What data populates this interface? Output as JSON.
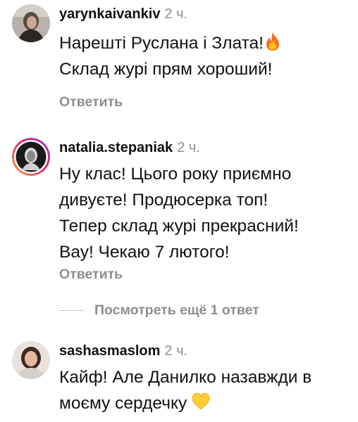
{
  "comments": [
    {
      "username": "yarynkaivankiv",
      "time": "2 ч.",
      "lines": [
        "Нарешті Руслана і Злата!",
        "Склад журі прям хороший!"
      ],
      "emoji": "fire-icon",
      "reply_label": "Ответить"
    },
    {
      "username": "natalia.stepaniak",
      "time": "2 ч.",
      "lines": [
        "Ну клас! Цього року приємно",
        "дивуєте! Продюсерка топ!",
        "Тепер склад журі прекрасний!",
        "Вау! Чекаю 7 лютого!"
      ],
      "reply_label": "Ответить"
    },
    {
      "username": "sashasmaslom",
      "time": "2 ч.",
      "lines": [
        "Кайф! Але Данилко назавжди в",
        "моєму сердечку"
      ],
      "emoji": "yellow-heart-icon"
    }
  ],
  "more_replies": {
    "label": "Посмотреть ещё 1 ответ"
  },
  "colors": {
    "text": "#111111",
    "secondary": "#8e8e8e",
    "story_ring_start": "#c13584",
    "story_ring_end": "#f77737"
  }
}
